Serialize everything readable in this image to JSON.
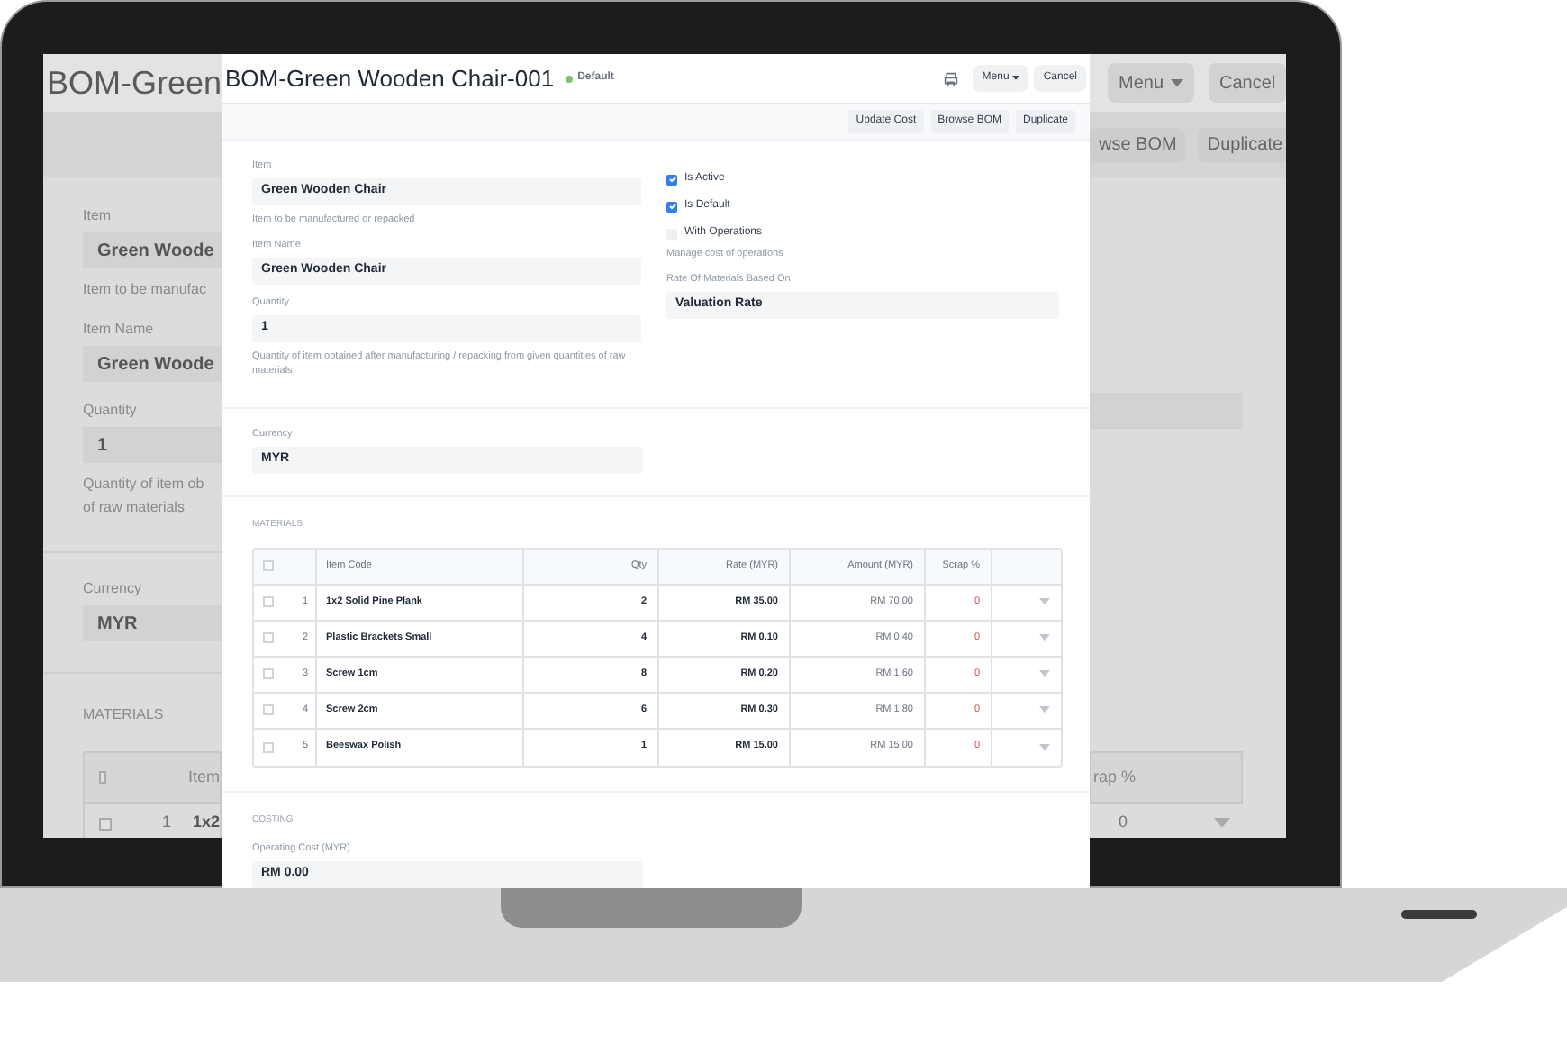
{
  "background_window": {
    "title": "BOM-Green",
    "menu_button": "Menu",
    "cancel_button": "Cancel",
    "toolbar_buttons": [
      "wse BOM",
      "Duplicate"
    ],
    "fields": [
      {
        "label": "Item",
        "value": "Green Woode",
        "help": [
          "Item to be manufac"
        ]
      },
      {
        "label": "Item Name",
        "value": "Green Woode"
      },
      {
        "label": "Quantity",
        "value": "1",
        "help": [
          "Quantity of item ob",
          "of raw materials"
        ]
      }
    ],
    "currency": {
      "label": "Currency",
      "value": "MYR"
    },
    "materials_heading": "MATERIALS",
    "table_left": {
      "header": "Item",
      "header_selected": false,
      "row_index": "1",
      "row_item": "1x2",
      "selected": false
    },
    "table_right": {
      "header": "rap %",
      "row_scrap": "0"
    }
  },
  "dialog": {
    "title": "BOM-Green Wooden Chair-001",
    "status": "Default",
    "menu_button": "Menu",
    "cancel_button": "Cancel",
    "toolbar_buttons": [
      "Update Cost",
      "Browse BOM",
      "Duplicate"
    ],
    "left_fields": [
      {
        "label": "Item",
        "value": "Green Wooden Chair",
        "help": "Item to be manufactured or repacked"
      },
      {
        "label": "Item Name",
        "value": "Green Wooden Chair"
      },
      {
        "label": "Quantity",
        "value": "1",
        "help": "Quantity of item obtained after manufacturing / repacking from given quantities of raw materials"
      }
    ],
    "checks": [
      {
        "label": "Is Active",
        "checked": true
      },
      {
        "label": "Is Default",
        "checked": true
      },
      {
        "label": "With Operations",
        "checked": false
      }
    ],
    "operations_help": "Manage cost of operations",
    "rate_field": {
      "label": "Rate Of Materials Based On",
      "value": "Valuation Rate"
    },
    "currency": {
      "label": "Currency",
      "value": "MYR"
    },
    "materials": {
      "heading": "MATERIALS",
      "all_selected": false,
      "columns": [
        "Item Code",
        "Qty",
        "Rate (MYR)",
        "Amount (MYR)",
        "Scrap %"
      ],
      "rows": [
        {
          "index": "1",
          "item_code": "1x2 Solid Pine Plank",
          "qty": "2",
          "rate": "RM 35.00",
          "amount": "RM 70.00",
          "scrap": "0",
          "selected": false
        },
        {
          "index": "2",
          "item_code": "Plastic Brackets Small",
          "qty": "4",
          "rate": "RM 0.10",
          "amount": "RM 0.40",
          "scrap": "0",
          "selected": false
        },
        {
          "index": "3",
          "item_code": "Screw 1cm",
          "qty": "8",
          "rate": "RM 0.20",
          "amount": "RM 1.60",
          "scrap": "0",
          "selected": false
        },
        {
          "index": "4",
          "item_code": "Screw 2cm",
          "qty": "6",
          "rate": "RM 0.30",
          "amount": "RM 1.80",
          "scrap": "0",
          "selected": false
        },
        {
          "index": "5",
          "item_code": "Beeswax Polish",
          "qty": "1",
          "rate": "RM 15.00",
          "amount": "RM 15.00",
          "scrap": "0",
          "selected": false
        }
      ]
    },
    "costing": {
      "heading": "COSTING",
      "label": "Operating Cost (MYR)",
      "value": "RM 0.00"
    }
  }
}
